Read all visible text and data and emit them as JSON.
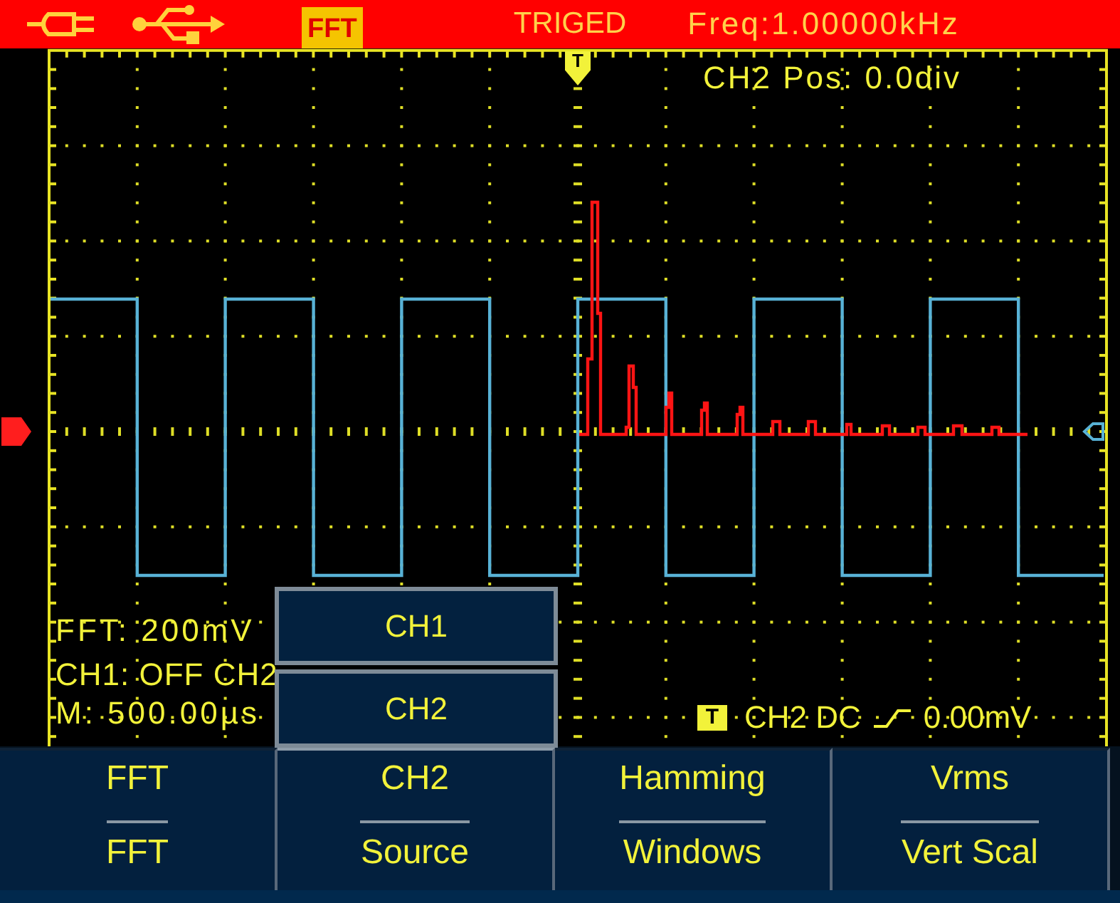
{
  "status_bar": {
    "fft_badge": "FFT",
    "trigger_status": "TRIGED",
    "frequency": "Freq:1.00000kHz"
  },
  "display": {
    "trigger_marker": "T",
    "position_readout": "CH2 Pos: 0.0div",
    "fft_scale": "FFT: 200mV",
    "channel_status": "CH1: OFF CH2",
    "timebase": "M: 500.00µs",
    "trigger": {
      "badge": "T",
      "source": "CH2 DC",
      "level": "0.00mV"
    }
  },
  "source_popup": {
    "options": [
      "CH1",
      "CH2"
    ]
  },
  "menu": [
    {
      "value": "FFT",
      "label": "FFT",
      "selected": false
    },
    {
      "value": "CH2",
      "label": "Source",
      "selected": true
    },
    {
      "value": "Hamming",
      "label": "Windows",
      "selected": false
    },
    {
      "value": "Vrms",
      "label": "Vert Scal",
      "selected": false
    }
  ]
}
